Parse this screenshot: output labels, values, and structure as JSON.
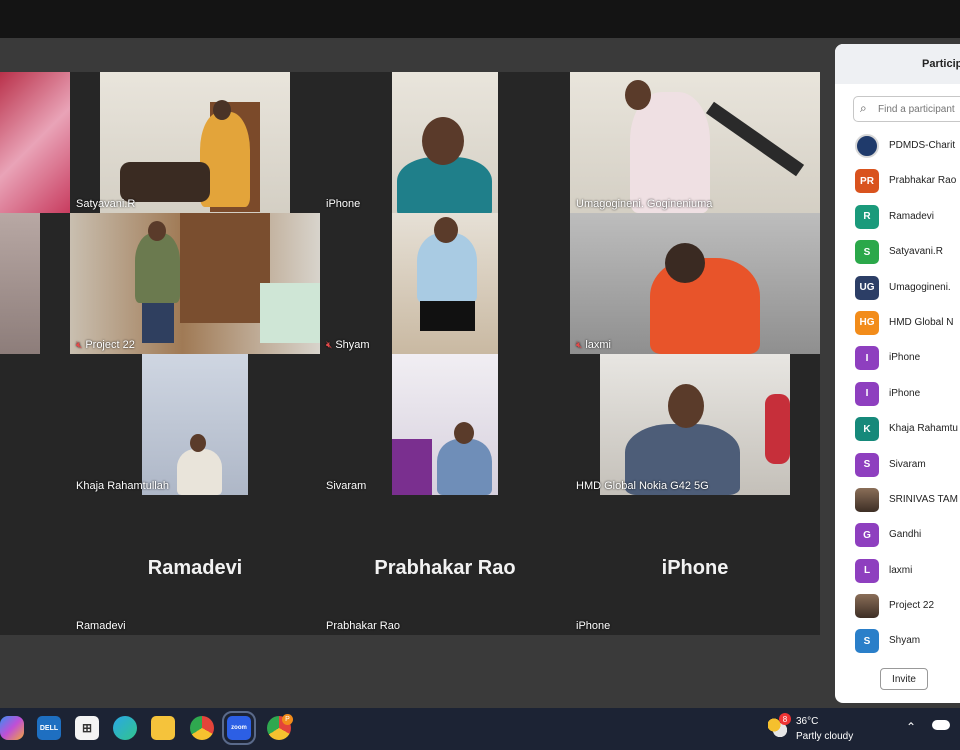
{
  "tiles": {
    "t1": {
      "name": ""
    },
    "t2": {
      "name": "Satyavani.R"
    },
    "t3": {
      "name": "iPhone"
    },
    "t4": {
      "name": "Umagogineni. Gogineniuma"
    },
    "t5": {
      "name": "Project 22"
    },
    "t6": {
      "name": "Shyam"
    },
    "t7": {
      "name": "laxmi"
    },
    "t8": {
      "name": "Khaja Rahamtullah"
    },
    "t9": {
      "name": "Sivaram"
    },
    "t10": {
      "name": "HMD Global Nokia G42 5G"
    },
    "t11": {
      "name": "Ramadevi",
      "big": "Ramadevi"
    },
    "t12": {
      "name": "Prabhakar Rao",
      "big": "Prabhakar Rao"
    },
    "t13": {
      "name": "iPhone",
      "big": "iPhone"
    }
  },
  "panel": {
    "title": "Particip",
    "search_placeholder": "Find a participant",
    "participants": [
      {
        "initials": "",
        "name": "PDMDS-Charit",
        "color": "#1f3a6b",
        "kind": "logo"
      },
      {
        "initials": "PR",
        "name": "Prabhakar Rao",
        "color": "#d9531e"
      },
      {
        "initials": "R",
        "name": "Ramadevi",
        "color": "#1a9a7b"
      },
      {
        "initials": "S",
        "name": "Satyavani.R",
        "color": "#2ba84a"
      },
      {
        "initials": "UG",
        "name": "Umagogineni.",
        "color": "#2c3e66"
      },
      {
        "initials": "HG",
        "name": "HMD Global N",
        "color": "#f28c1a"
      },
      {
        "initials": "I",
        "name": "iPhone",
        "color": "#8e3fbf"
      },
      {
        "initials": "I",
        "name": "iPhone",
        "color": "#8e3fbf"
      },
      {
        "initials": "K",
        "name": "Khaja Rahamtu",
        "color": "#16897a"
      },
      {
        "initials": "S",
        "name": "Sivaram",
        "color": "#8e3fbf"
      },
      {
        "initials": "",
        "name": "SRINIVAS TAM",
        "color": "#6b5a4a",
        "kind": "photo"
      },
      {
        "initials": "G",
        "name": "Gandhi",
        "color": "#8e3fbf"
      },
      {
        "initials": "L",
        "name": "laxmi",
        "color": "#8e3fbf"
      },
      {
        "initials": "",
        "name": "Project 22",
        "color": "#8a6e58",
        "kind": "photo"
      },
      {
        "initials": "S",
        "name": "Shyam",
        "color": "#2a7fc9"
      }
    ],
    "invite_label": "Invite"
  },
  "taskbar": {
    "weather_temp": "36°C",
    "weather_desc": "Partly cloudy",
    "weather_badge": "8",
    "chrome_badge": "P"
  }
}
